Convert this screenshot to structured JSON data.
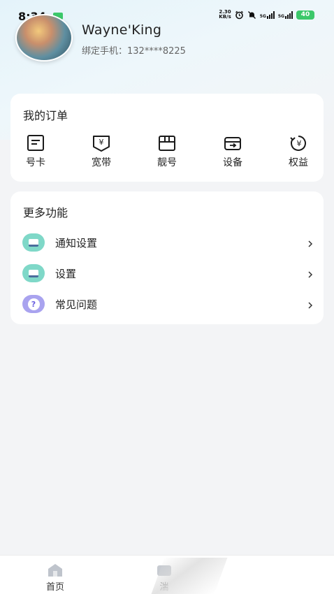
{
  "status_bar": {
    "time": "8:34",
    "net_speed_value": "2.30",
    "net_speed_unit": "KB/s",
    "signal1": "5G",
    "signal2": "5G",
    "battery": "40"
  },
  "profile": {
    "name": "Wayne'King",
    "phone": "绑定手机：132****8225"
  },
  "orders": {
    "title": "我的订单",
    "items": [
      {
        "label": "号卡",
        "icon": "sim-card-icon"
      },
      {
        "label": "宽带",
        "icon": "broadband-icon"
      },
      {
        "label": "靓号",
        "icon": "box-icon"
      },
      {
        "label": "设备",
        "icon": "device-icon"
      },
      {
        "label": "权益",
        "icon": "rights-icon"
      }
    ]
  },
  "more": {
    "title": "更多功能",
    "items": [
      {
        "label": "通知设置",
        "icon": "notification-icon"
      },
      {
        "label": "设置",
        "icon": "settings-icon"
      },
      {
        "label": "常见问题",
        "icon": "question-icon"
      }
    ]
  },
  "bottom_nav": {
    "items": [
      {
        "label": "首页",
        "icon": "home-icon"
      },
      {
        "label": "湍",
        "icon": "nav-icon"
      }
    ]
  }
}
